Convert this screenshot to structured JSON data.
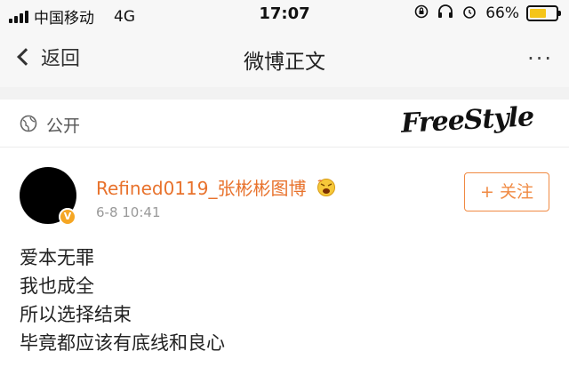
{
  "status_bar": {
    "carrier": "中国移动",
    "network": "4G",
    "time": "17:07",
    "battery": "66%",
    "battery_level": 0.66,
    "icons": [
      "signal-icon",
      "lock-rotation-icon",
      "headphones-icon",
      "alarm-icon",
      "battery-icon"
    ]
  },
  "nav": {
    "back_label": "返回",
    "title": "微博正文",
    "more_label": "···"
  },
  "visibility": {
    "label": "公开",
    "watermark": "FreeStyle"
  },
  "post": {
    "username": "Refined0119_张彬彬图博",
    "timestamp": "6-8 10:41",
    "verified_label": "V",
    "follow_label": "+ 关注",
    "lines": [
      "爱本无罪",
      "我也成全",
      "所以选择结束",
      "毕竟都应该有底线和良心"
    ]
  },
  "colors": {
    "accent_orange": "#e8722c",
    "follow_border": "#f08a43",
    "battery_yellow": "#f5c518",
    "verified_badge": "#f5a623"
  }
}
